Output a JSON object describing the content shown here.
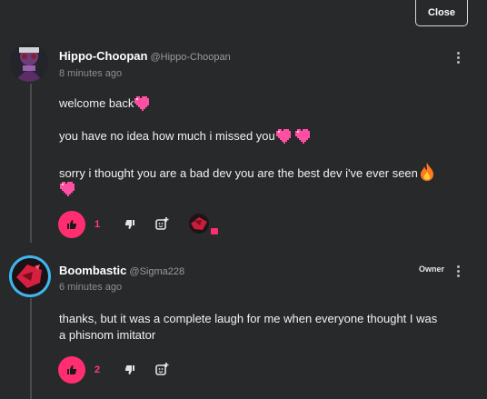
{
  "dialog": {
    "close_label": "Close"
  },
  "comments": [
    {
      "author": "Hippo-Choopan",
      "handle": "@Hippo-Choopan",
      "time": "8 minutes ago",
      "lines": [
        "welcome back",
        "you have no idea how much i missed you",
        "sorry i thought you are a bad dev you are the best dev i've ever seen"
      ],
      "likes": "1"
    },
    {
      "author": "Boombastic",
      "handle": "@Sigma228",
      "badge": "Owner",
      "time": "6 minutes ago",
      "lines": [
        "thanks, but it was a complete laugh for me when everyone thought I was",
        "a phisnom imitator"
      ],
      "likes": "2"
    }
  ],
  "colors": {
    "accent": "#ff2e70",
    "background": "#28292b",
    "heart": "#ff4fa3"
  },
  "icons": [
    "close-icon",
    "kebab-menu-icon",
    "thumbs-up-icon",
    "thumbs-down-icon",
    "add-reaction-icon",
    "heart-emoji",
    "fire-emoji"
  ]
}
